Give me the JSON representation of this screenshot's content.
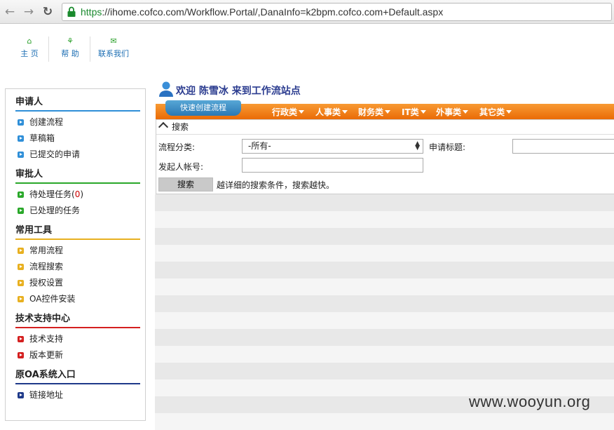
{
  "browser": {
    "url_scheme": "https",
    "url_rest": "://ihome.cofco.com/Workflow.Portal/,DanaInfo=k2bpm.cofco.com+Default.aspx"
  },
  "topnav": {
    "items": [
      {
        "label": "主 页",
        "icon": "home-icon"
      },
      {
        "label": "帮 助",
        "icon": "help-icon"
      },
      {
        "label": "联系我们",
        "icon": "mail-icon"
      }
    ]
  },
  "sidebar": {
    "sections": [
      {
        "title": "申请人",
        "color": "#2f8fd8",
        "items": [
          {
            "label": "创建流程"
          },
          {
            "label": "草稿箱"
          },
          {
            "label": "已提交的申请"
          }
        ]
      },
      {
        "title": "审批人",
        "color": "#2aa82a",
        "items": [
          {
            "label": "待处理任务(",
            "count": "0",
            "suffix": ")"
          },
          {
            "label": "已处理的任务"
          }
        ]
      },
      {
        "title": "常用工具",
        "color": "#e8b020",
        "items": [
          {
            "label": "常用流程"
          },
          {
            "label": "流程搜索"
          },
          {
            "label": "授权设置"
          },
          {
            "label": "OA控件安装"
          }
        ]
      },
      {
        "title": "技术支持中心",
        "color": "#d42020",
        "items": [
          {
            "label": "技术支持"
          },
          {
            "label": "版本更新"
          }
        ]
      },
      {
        "title": "原OA系统入口",
        "color": "#1f3a8a",
        "items": [
          {
            "label": "链接地址"
          }
        ]
      }
    ]
  },
  "welcome": {
    "text": "欢迎 陈雪冰 来到工作流站点"
  },
  "menu": {
    "quick_label": "快速创建流程",
    "items": [
      "行政类",
      "人事类",
      "财务类",
      "IT类",
      "外事类",
      "其它类"
    ]
  },
  "search": {
    "title": "搜索",
    "category_label": "流程分类:",
    "category_value": "-所有-",
    "subject_label": "申请标题:",
    "initiator_label": "发起人帐号:",
    "button_label": "搜索",
    "hint": "越详细的搜索条件，搜索越快。"
  },
  "watermark": "www.wooyun.org"
}
